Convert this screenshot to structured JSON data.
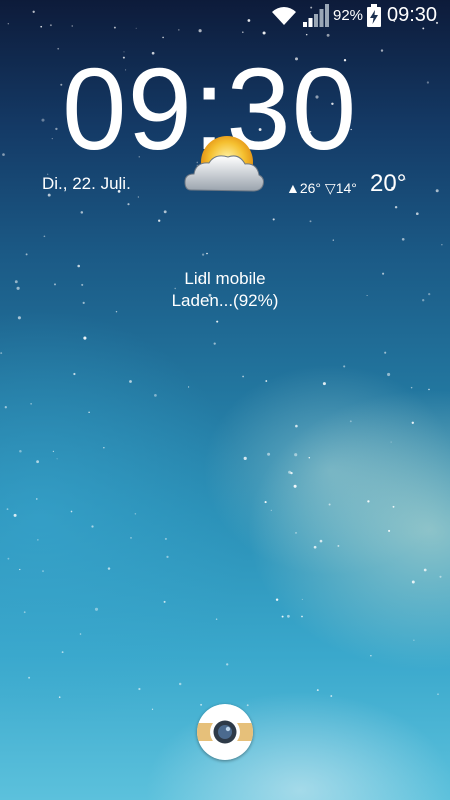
{
  "status_bar": {
    "battery_percent_text": "92%",
    "time": "09:30",
    "icons": [
      "wifi-icon",
      "signal-icon",
      "battery-charging-icon"
    ]
  },
  "lock_screen": {
    "clock": "09:30",
    "date": "Di., 22. Juli.",
    "weather": {
      "icon": "partly-cloudy-icon",
      "high": "26°",
      "low": "14°",
      "current": "20°"
    },
    "carrier": "Lidl mobile",
    "charging_status": "Laden...(92%)",
    "shortcut_icon": "camera-icon"
  },
  "colors": {
    "sky_top": "#0d1b3a",
    "sky_bottom": "#5cc1dc",
    "text": "#ffffff",
    "camera_ring": "#e6c07a"
  }
}
